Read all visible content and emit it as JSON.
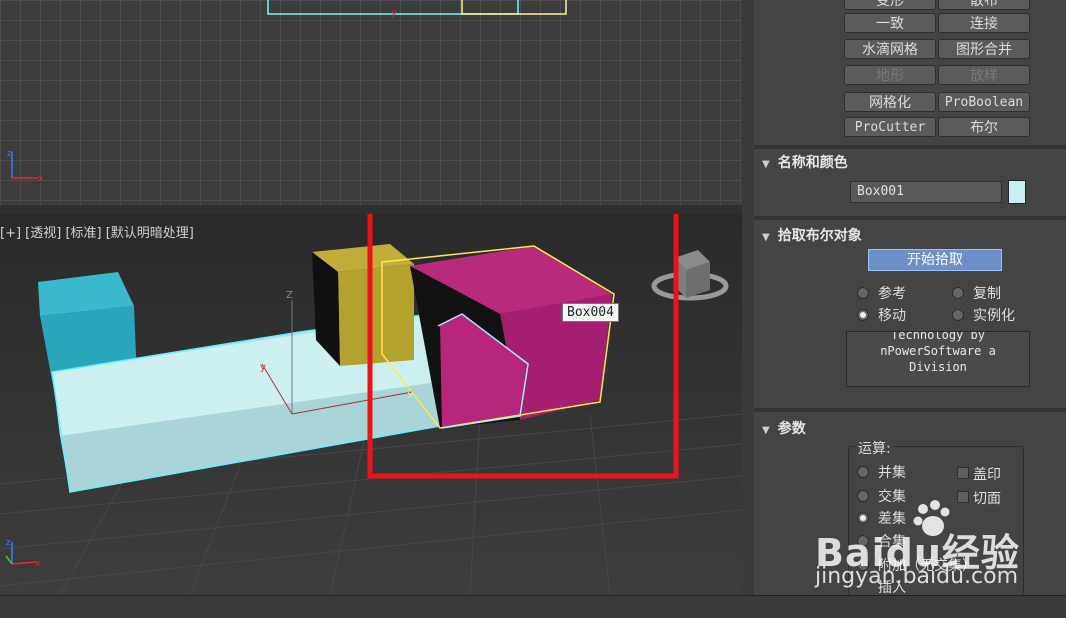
{
  "viewport_persp": {
    "label": "[+] [透视] [标准] [默认明暗处理]",
    "tooltip": "Box004"
  },
  "compound_buttons": [
    {
      "label": "变形",
      "disabled": false
    },
    {
      "label": "散布",
      "disabled": false
    },
    {
      "label": "一致",
      "disabled": false
    },
    {
      "label": "连接",
      "disabled": false
    },
    {
      "label": "水滴网格",
      "disabled": false
    },
    {
      "label": "图形合并",
      "disabled": false
    },
    {
      "label": "地形",
      "disabled": true
    },
    {
      "label": "放样",
      "disabled": true
    },
    {
      "label": "网格化",
      "disabled": false
    },
    {
      "label": "ProBoolean",
      "disabled": false
    },
    {
      "label": "ProCutter",
      "disabled": false
    },
    {
      "label": "布尔",
      "disabled": false
    }
  ],
  "name_color": {
    "title": "名称和颜色",
    "object_name": "Box001",
    "swatch_color": "#c8f0f4"
  },
  "pick_boolean": {
    "title": "拾取布尔对象",
    "start_pick": "开始拾取",
    "options": [
      "参考",
      "复制",
      "移动",
      "实例化"
    ],
    "selected": "移动",
    "credits": [
      "Technology by",
      "nPowerSoftware a",
      "Division"
    ]
  },
  "parameters": {
    "title": "参数",
    "group": "运算:",
    "operations": [
      "并集",
      "交集",
      "差集",
      "合集",
      "附加（无交集）",
      "插入"
    ],
    "selected": "差集",
    "options": [
      "盖印",
      "切面"
    ]
  },
  "watermark": {
    "brand": "Baidu经验",
    "url": "jingyan.baidu.com"
  },
  "colors": {
    "selection_frame": "#e8141a",
    "wire_cyan": "#66f0ff",
    "wire_yellow": "#ffe84a",
    "accent_button": "#6d8fc9"
  }
}
